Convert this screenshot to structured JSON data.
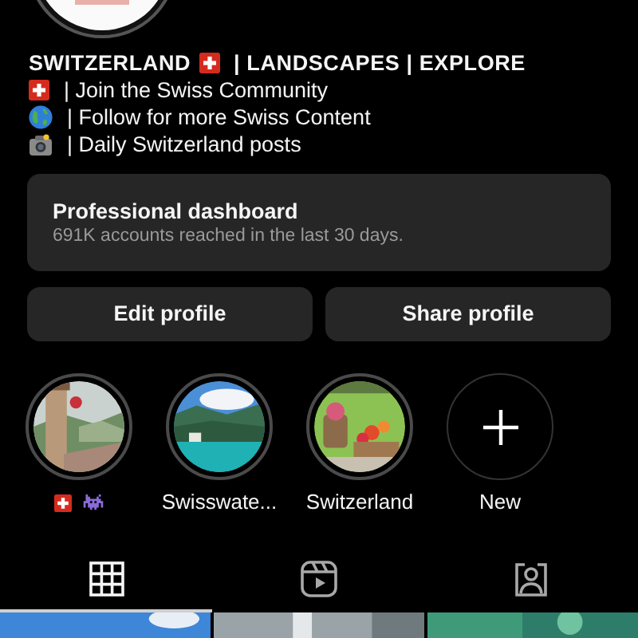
{
  "bio": [
    {
      "kind": "title",
      "parts": [
        "SWITZERLAND",
        "| LANDSCAPES | EXPLORE"
      ]
    },
    {
      "kind": "flag",
      "text": "| Join the Swiss Community"
    },
    {
      "kind": "globe",
      "text": "| Follow for more Swiss Content"
    },
    {
      "kind": "camera",
      "text": "| Daily Switzerland posts"
    }
  ],
  "dashboard": {
    "title": "Professional dashboard",
    "subtitle": "691K accounts reached in the last 30 days."
  },
  "buttons": [
    "Edit profile",
    "Share profile"
  ],
  "highlights": [
    {
      "kind": "emoji"
    },
    {
      "kind": "story",
      "label": "Swisswate..."
    },
    {
      "kind": "story",
      "label": "Switzerland"
    },
    {
      "kind": "new",
      "label": "New"
    }
  ],
  "tabs": [
    {
      "kind": "grid",
      "selected": true
    },
    {
      "kind": "reels",
      "selected": false
    },
    {
      "kind": "tagged",
      "selected": false
    }
  ],
  "posts": [
    {
      "kind": "picture"
    },
    {
      "kind": "picture"
    },
    {
      "kind": "picture"
    }
  ]
}
